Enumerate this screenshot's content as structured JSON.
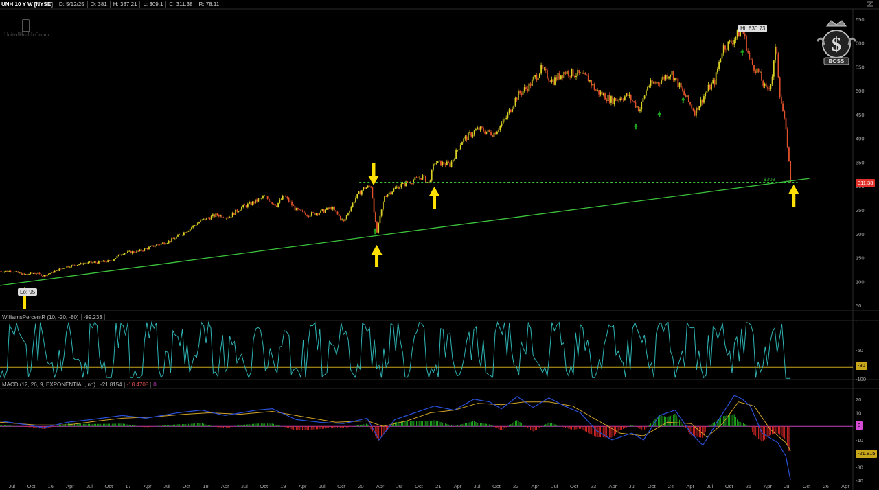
{
  "header": {
    "symbol": "UNH 10 Y W [NYSE]",
    "date": "D: 5/12/25",
    "open": "O: 381",
    "high": "H: 387.21",
    "low": "L: 309.1",
    "close": "C: 311.38",
    "range": "R: 78.11"
  },
  "logos": {
    "company": "UnitedHealth Group",
    "boss": "BOSS"
  },
  "annotations": {
    "hi_label": "Hi: 630.73",
    "lo_label": "Lo: 95",
    "level_label": "$308",
    "last_price": "311.38"
  },
  "chart_data": [
    {
      "type": "line",
      "title": "UNH 10 Y W [NYSE]",
      "ylim": [
        40,
        670
      ],
      "yticks": [
        50,
        100,
        150,
        200,
        250,
        300,
        350,
        400,
        450,
        500,
        550,
        600,
        650
      ],
      "xticks": [
        "Jul",
        "Oct",
        "16",
        "Apr",
        "Jul",
        "Oct",
        "17",
        "Apr",
        "Jul",
        "Oct",
        "18",
        "Apr",
        "Jul",
        "Oct",
        "19",
        "Apr",
        "Jul",
        "Oct",
        "20",
        "Apr",
        "Jul",
        "Oct",
        "21",
        "Apr",
        "Jul",
        "Oct",
        "22",
        "Apr",
        "Jul",
        "Oct",
        "23",
        "Apr",
        "Jul",
        "Oct",
        "24",
        "Apr",
        "Jul",
        "Oct",
        "25",
        "Apr",
        "Jul",
        "Oct",
        "26",
        "Apr"
      ],
      "x_start": 2015.45,
      "x_end": 2026.25,
      "series": [
        {
          "name": "UNH",
          "points": [
            [
              2015.45,
              121
            ],
            [
              2015.6,
              122
            ],
            [
              2015.75,
              115
            ],
            [
              2015.9,
              118
            ],
            [
              2016.0,
              112
            ],
            [
              2016.15,
              122
            ],
            [
              2016.3,
              132
            ],
            [
              2016.5,
              138
            ],
            [
              2016.65,
              140
            ],
            [
              2016.85,
              143
            ],
            [
              2017.0,
              160
            ],
            [
              2017.2,
              163
            ],
            [
              2017.4,
              175
            ],
            [
              2017.6,
              185
            ],
            [
              2017.8,
              205
            ],
            [
              2018.0,
              228
            ],
            [
              2018.2,
              240
            ],
            [
              2018.35,
              235
            ],
            [
              2018.5,
              255
            ],
            [
              2018.65,
              265
            ],
            [
              2018.8,
              278
            ],
            [
              2018.95,
              260
            ],
            [
              2019.05,
              280
            ],
            [
              2019.2,
              250
            ],
            [
              2019.35,
              240
            ],
            [
              2019.5,
              245
            ],
            [
              2019.65,
              255
            ],
            [
              2019.8,
              225
            ],
            [
              2019.95,
              275
            ],
            [
              2020.05,
              295
            ],
            [
              2020.15,
              300
            ],
            [
              2020.22,
              200
            ],
            [
              2020.32,
              280
            ],
            [
              2020.5,
              300
            ],
            [
              2020.65,
              310
            ],
            [
              2020.8,
              320
            ],
            [
              2020.88,
              305
            ],
            [
              2020.95,
              350
            ],
            [
              2021.15,
              345
            ],
            [
              2021.3,
              395
            ],
            [
              2021.5,
              420
            ],
            [
              2021.7,
              410
            ],
            [
              2021.85,
              440
            ],
            [
              2022.0,
              490
            ],
            [
              2022.15,
              510
            ],
            [
              2022.3,
              545
            ],
            [
              2022.45,
              520
            ],
            [
              2022.6,
              540
            ],
            [
              2022.75,
              535
            ],
            [
              2022.9,
              525
            ],
            [
              2023.0,
              500
            ],
            [
              2023.2,
              480
            ],
            [
              2023.4,
              490
            ],
            [
              2023.55,
              460
            ],
            [
              2023.65,
              510
            ],
            [
              2023.8,
              520
            ],
            [
              2023.95,
              540
            ],
            [
              2024.1,
              495
            ],
            [
              2024.25,
              455
            ],
            [
              2024.4,
              500
            ],
            [
              2024.5,
              520
            ],
            [
              2024.6,
              590
            ],
            [
              2024.7,
              600
            ],
            [
              2024.8,
              620
            ],
            [
              2024.85,
              630
            ],
            [
              2024.95,
              560
            ],
            [
              2025.05,
              540
            ],
            [
              2025.15,
              500
            ],
            [
              2025.22,
              520
            ],
            [
              2025.28,
              600
            ],
            [
              2025.32,
              500
            ],
            [
              2025.38,
              440
            ],
            [
              2025.42,
              390
            ],
            [
              2025.46,
              311
            ]
          ]
        },
        {
          "name": "support trendline",
          "points": [
            [
              2015.45,
              92
            ],
            [
              2025.7,
              316
            ]
          ]
        },
        {
          "name": "$308 level",
          "points": [
            [
              2020.0,
              308
            ],
            [
              2025.55,
              308
            ]
          ]
        }
      ],
      "highlights": {
        "high": {
          "x": 2024.85,
          "y": 630.73
        },
        "low": {
          "x": 2015.55,
          "y": 95
        },
        "last": 311.38,
        "level": 308,
        "up_markers": [
          [
            2020.2,
            205
          ],
          [
            2024.85,
            580
          ],
          [
            2023.5,
            425
          ],
          [
            2023.8,
            450
          ],
          [
            2024.1,
            480
          ]
        ]
      },
      "colors": {
        "up": "#d9d024",
        "down": "#e0512b",
        "trend": "#3cc43c",
        "level": "#3cc43c",
        "arrow": "#ffe000",
        "signal": "#1ea51e"
      }
    },
    {
      "type": "line",
      "title": "WilliamsPercentR (10, -20, -80)",
      "current": "-99.233",
      "ylim": [
        -100,
        0
      ],
      "yticks": [
        0,
        -50,
        -100
      ],
      "threshold": -80,
      "threshold_label": "-80",
      "color": "#2fb3b3",
      "threshold_color": "#c8a61c"
    },
    {
      "type": "line",
      "title": "MACD (12, 26, 9, EXPONENTIAL, no)",
      "value": "-21.8154",
      "avg": "-18.4708",
      "diff": "0",
      "ylim": [
        -42,
        27
      ],
      "yticks": [
        20,
        10,
        0,
        -10,
        -20,
        -30,
        -40
      ],
      "last_label": "-21.815",
      "zero_label": "0",
      "series": [
        {
          "name": "Value",
          "points": [
            [
              2015.45,
              4
            ],
            [
              2015.8,
              1
            ],
            [
              2016.0,
              -1
            ],
            [
              2016.3,
              3
            ],
            [
              2016.6,
              5
            ],
            [
              2017.0,
              8
            ],
            [
              2017.3,
              6
            ],
            [
              2017.7,
              10
            ],
            [
              2018.0,
              12
            ],
            [
              2018.3,
              8
            ],
            [
              2018.7,
              12
            ],
            [
              2018.9,
              13
            ],
            [
              2019.2,
              5
            ],
            [
              2019.5,
              3
            ],
            [
              2019.8,
              2
            ],
            [
              2020.1,
              6
            ],
            [
              2020.25,
              -10
            ],
            [
              2020.45,
              5
            ],
            [
              2020.7,
              10
            ],
            [
              2020.95,
              15
            ],
            [
              2021.2,
              12
            ],
            [
              2021.45,
              20
            ],
            [
              2021.65,
              18
            ],
            [
              2021.8,
              13
            ],
            [
              2022.0,
              22
            ],
            [
              2022.2,
              14
            ],
            [
              2022.4,
              21
            ],
            [
              2022.6,
              15
            ],
            [
              2022.8,
              10
            ],
            [
              2023.0,
              -3
            ],
            [
              2023.2,
              -10
            ],
            [
              2023.45,
              -5
            ],
            [
              2023.6,
              -10
            ],
            [
              2023.8,
              8
            ],
            [
              2024.0,
              12
            ],
            [
              2024.2,
              -5
            ],
            [
              2024.35,
              -14
            ],
            [
              2024.55,
              5
            ],
            [
              2024.75,
              23
            ],
            [
              2024.85,
              20
            ],
            [
              2024.95,
              15
            ],
            [
              2025.1,
              -5
            ],
            [
              2025.3,
              -12
            ],
            [
              2025.4,
              -22
            ],
            [
              2025.46,
              -40
            ]
          ]
        },
        {
          "name": "Avg",
          "points": [
            [
              2015.45,
              3
            ],
            [
              2015.9,
              1
            ],
            [
              2016.3,
              1
            ],
            [
              2016.7,
              4
            ],
            [
              2017.0,
              6
            ],
            [
              2017.4,
              7
            ],
            [
              2017.8,
              9
            ],
            [
              2018.1,
              10
            ],
            [
              2018.5,
              9
            ],
            [
              2018.9,
              11
            ],
            [
              2019.3,
              7
            ],
            [
              2019.7,
              3
            ],
            [
              2020.1,
              4
            ],
            [
              2020.3,
              0
            ],
            [
              2020.6,
              4
            ],
            [
              2020.9,
              10
            ],
            [
              2021.2,
              12
            ],
            [
              2021.5,
              17
            ],
            [
              2021.8,
              16
            ],
            [
              2022.1,
              18
            ],
            [
              2022.4,
              18
            ],
            [
              2022.7,
              15
            ],
            [
              2023.0,
              5
            ],
            [
              2023.3,
              -5
            ],
            [
              2023.6,
              -7
            ],
            [
              2023.9,
              3
            ],
            [
              2024.2,
              2
            ],
            [
              2024.4,
              -8
            ],
            [
              2024.6,
              2
            ],
            [
              2024.8,
              18
            ],
            [
              2025.0,
              15
            ],
            [
              2025.2,
              -2
            ],
            [
              2025.4,
              -12
            ],
            [
              2025.46,
              -18
            ]
          ]
        }
      ],
      "colors": {
        "value": "#2a4fd6",
        "avg": "#d2a52a",
        "hist_pos": "#1ea51e",
        "hist_neg": "#d02626",
        "zero": "#c040c0"
      }
    }
  ]
}
